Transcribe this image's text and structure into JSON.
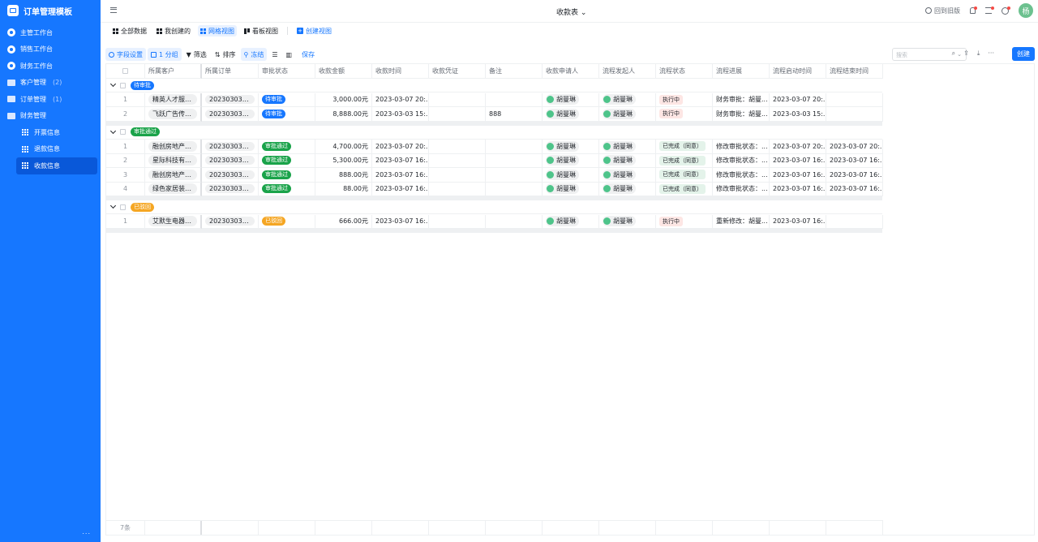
{
  "sidebar": {
    "app_title": "订单管理模板",
    "items": [
      {
        "label": "主管工作台"
      },
      {
        "label": "销售工作台"
      },
      {
        "label": "财务工作台"
      },
      {
        "label": "客户管理",
        "count": "(2)"
      },
      {
        "label": "订单管理",
        "count": "(1)"
      },
      {
        "label": "财务管理"
      },
      {
        "label": "开票信息"
      },
      {
        "label": "退款信息"
      },
      {
        "label": "收款信息"
      }
    ],
    "more": "..."
  },
  "topbar": {
    "title": "收款表",
    "back_old": "回到旧版",
    "avatar_text": "杨"
  },
  "view_tabs": [
    "全部数据",
    "我创建的",
    "网格视图",
    "看板视图",
    "创建视图"
  ],
  "toolbar": {
    "field_settings": "字段设置",
    "group": "1 分组",
    "filter": "筛选",
    "sort": "排序",
    "freeze": "冻结",
    "save": "保存",
    "search_placeholder": "搜索",
    "create": "创建"
  },
  "columns": [
    "所属客户",
    "所属订单",
    "审批状态",
    "收款金额",
    "收款时间",
    "收款凭证",
    "备注",
    "收款申请人",
    "流程发起人",
    "流程状态",
    "流程进展",
    "流程启动时间",
    "流程结束时间"
  ],
  "groups": [
    {
      "label": "待审批",
      "color": "#1677ff",
      "rows": [
        {
          "no": "1",
          "customer": "精英人才服务...",
          "order": "20230303031...",
          "status": "待审批",
          "amount": "3,000.00元",
          "time": "2023-03-07 20:...",
          "voucher": "",
          "note": "",
          "applicant": "胡曼琳",
          "initiator": "胡曼琳",
          "flow_status": "执行中",
          "progress": "财务审批：胡曼...",
          "start": "2023-03-07 20:...",
          "end": ""
        },
        {
          "no": "2",
          "customer": "飞跃广告传媒...",
          "order": "20230303039...",
          "status": "待审批",
          "amount": "8,888.00元",
          "time": "2023-03-03 15:...",
          "voucher": "",
          "note": "888",
          "applicant": "胡曼琳",
          "initiator": "胡曼琳",
          "flow_status": "执行中",
          "progress": "财务审批：胡曼...",
          "start": "2023-03-03 15:...",
          "end": ""
        }
      ]
    },
    {
      "label": "审批通过",
      "color": "#1aa34a",
      "rows": [
        {
          "no": "1",
          "customer": "融创房地产开...",
          "order": "20230303031...",
          "status": "审批通过",
          "amount": "4,700.00元",
          "time": "2023-03-07 20:...",
          "voucher": "",
          "note": "",
          "applicant": "胡曼琳",
          "initiator": "胡曼琳",
          "flow_status": "已完成（同意）",
          "progress": "修改审批状态：...",
          "start": "2023-03-07 20:...",
          "end": "2023-03-07 20:..."
        },
        {
          "no": "2",
          "customer": "星际科技有限...",
          "order": "20230303037...",
          "status": "审批通过",
          "amount": "5,300.00元",
          "time": "2023-03-07 16:...",
          "voucher": "",
          "note": "",
          "applicant": "胡曼琳",
          "initiator": "胡曼琳",
          "flow_status": "已完成（同意）",
          "progress": "修改审批状态：...",
          "start": "2023-03-07 16:...",
          "end": "2023-03-07 16:..."
        },
        {
          "no": "3",
          "customer": "融创房地产开...",
          "order": "20230303039...",
          "status": "审批通过",
          "amount": "888.00元",
          "time": "2023-03-07 16:...",
          "voucher": "",
          "note": "",
          "applicant": "胡曼琳",
          "initiator": "胡曼琳",
          "flow_status": "已完成（同意）",
          "progress": "修改审批状态：...",
          "start": "2023-03-07 16:...",
          "end": "2023-03-07 16:..."
        },
        {
          "no": "4",
          "customer": "绿色家居装饰...",
          "order": "20230303035...",
          "status": "审批通过",
          "amount": "88.00元",
          "time": "2023-03-07 16:...",
          "voucher": "",
          "note": "",
          "applicant": "胡曼琳",
          "initiator": "胡曼琳",
          "flow_status": "已完成（同意）",
          "progress": "修改审批状态：...",
          "start": "2023-03-07 16:...",
          "end": "2023-03-07 16:..."
        }
      ]
    },
    {
      "label": "已驳回",
      "color": "#f5a623",
      "rows": [
        {
          "no": "1",
          "customer": "艾默生电器有...",
          "order": "20230303036...",
          "status": "已驳回",
          "amount": "666.00元",
          "time": "2023-03-07 16:...",
          "voucher": "",
          "note": "",
          "applicant": "胡曼琳",
          "initiator": "胡曼琳",
          "flow_status": "执行中",
          "progress": "重新修改：胡曼...",
          "start": "2023-03-07 16:...",
          "end": ""
        }
      ]
    }
  ],
  "footer_count": "7条"
}
